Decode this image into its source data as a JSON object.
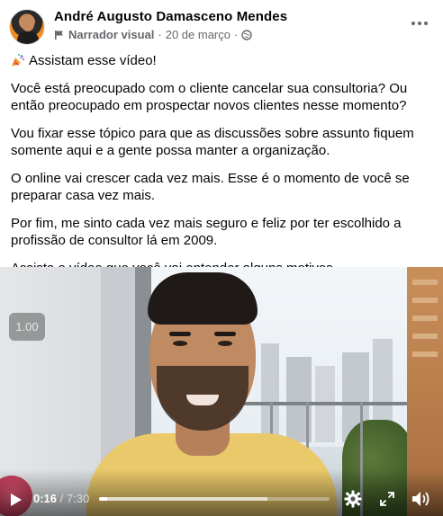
{
  "post": {
    "author": "André Augusto Damasceno Mendes",
    "role": "Narrador visual",
    "separator": "·",
    "date": "20 de março",
    "separator2": "·",
    "paragraphs": [
      "Assistam esse vídeo!",
      "Você está preocupado com o cliente cancelar sua consultoria? Ou então preocupado em prospectar novos clientes nesse momento?",
      "Vou fixar esse tópico para que as discussões sobre assunto fiquem somente aqui e a gente possa manter a organização.",
      "O online vai crescer cada vez mais. Esse é o momento de você se preparar casa vez mais.",
      "Por fim, me sinto cada vez mais seguro e feliz por ter escolhido a profissão de consultor lá em 2009.",
      "Assista o vídeo que você vai entender alguns motivos."
    ]
  },
  "video": {
    "playback_speed": "1.00",
    "current_time": "0:16",
    "time_separator": " / ",
    "duration": "7:30",
    "progress_fraction": 0.036,
    "buffered_fraction": 0.73
  },
  "icons": {
    "avatar": "avatar",
    "role_icon": "flag-icon",
    "audience_icon": "globe-icon",
    "party": "party-popper-icon",
    "more": "more-options-icon",
    "play": "play-icon",
    "settings": "gear-icon",
    "fullscreen": "expand-icon",
    "volume": "volume-icon"
  }
}
